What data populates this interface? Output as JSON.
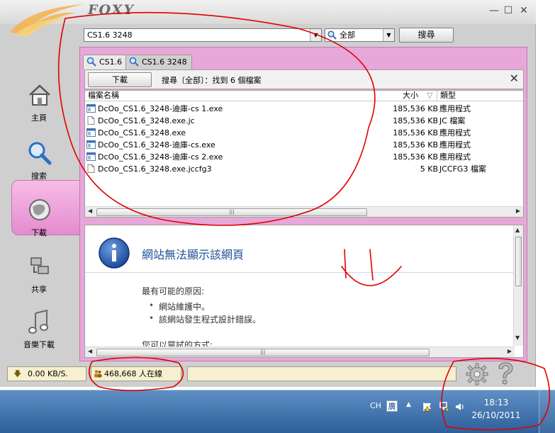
{
  "app": {
    "logo_text": "FOXY",
    "window_controls": {
      "minimize": "—",
      "maximize": "☐",
      "close": "✕"
    }
  },
  "search": {
    "query": "CS1.6 3248",
    "scope": "全部",
    "button_label": "搜尋"
  },
  "sidebar": {
    "items": [
      {
        "label": "主頁",
        "icon": "home-icon",
        "active": false
      },
      {
        "label": "搜索",
        "icon": "magnifier-icon",
        "active": true
      },
      {
        "label": "下載",
        "icon": "globe-download-icon",
        "active": false
      },
      {
        "label": "共享",
        "icon": "share-icon",
        "active": false
      },
      {
        "label": "音樂下載",
        "icon": "music-note-icon",
        "active": false
      }
    ]
  },
  "tabs": [
    {
      "label": "CS1.6"
    },
    {
      "label": "CS1.6 3248"
    }
  ],
  "toolbar": {
    "download_label": "下載",
    "status": "搜尋〔全部〕：找到 6 個檔案",
    "close_glyph": "✕"
  },
  "file_list": {
    "columns": {
      "name": "檔案名稱",
      "size": "大小",
      "sort_indicator": "▽",
      "type": "類型"
    },
    "rows": [
      {
        "name": "DcOo_CS1.6_3248-迪庫-cs 1.exe",
        "size": "185,536 KB",
        "type": "應用程式",
        "icon": "exe-icon"
      },
      {
        "name": "DcOo_CS1.6_3248.exe.jc",
        "size": "185,536 KB",
        "type": "JC 檔案",
        "icon": "file-icon"
      },
      {
        "name": "DcOo_CS1.6_3248.exe",
        "size": "185,536 KB",
        "type": "應用程式",
        "icon": "exe-icon"
      },
      {
        "name": "DcOo_CS1.6_3248-迪庫-cs.exe",
        "size": "185,536 KB",
        "type": "應用程式",
        "icon": "exe-icon"
      },
      {
        "name": "DcOo_CS1.6_3248-迪庫-cs 2.exe",
        "size": "185,536 KB",
        "type": "應用程式",
        "icon": "exe-icon"
      },
      {
        "name": "DcOo_CS1.6_3248.exe.jccfg3",
        "size": "5 KB",
        "type": "JCCFG3 檔案",
        "icon": "file-icon"
      }
    ]
  },
  "webview": {
    "title": "網站無法顯示該網頁",
    "cause_heading": "最有可能的原因:",
    "causes": [
      "網站維護中。",
      "該網站發生程式設計錯誤。"
    ],
    "cut_off_text": "您可以嘗試的方式:"
  },
  "statusbar": {
    "speed": "0.00 KB/S.",
    "online_users": "468,668 人在線"
  },
  "taskbar": {
    "lang": "CH",
    "ime": "廣",
    "time": "18:13",
    "date": "26/10/2011"
  },
  "colors": {
    "accent_pink": "#e7a7d9",
    "link_blue": "#1f4e99",
    "annotation_red": "#e00000"
  }
}
